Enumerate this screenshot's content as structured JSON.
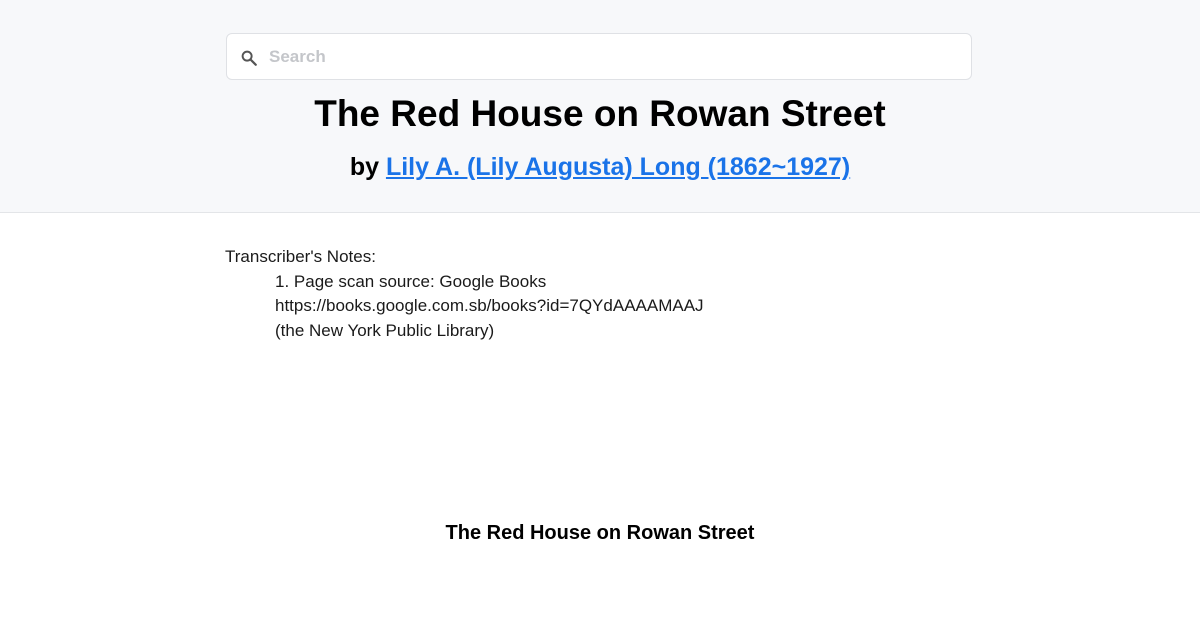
{
  "search": {
    "placeholder": "Search",
    "value": ""
  },
  "book": {
    "title": "The Red House on Rowan Street",
    "by_prefix": "by ",
    "author": "Lily A. (Lily Augusta) Long (1862~1927)"
  },
  "notes": {
    "heading": "Transcriber's Notes:",
    "lines": [
      "1. Page scan source: Google Books",
      "https://books.google.com.sb/books?id=7QYdAAAAMAAJ",
      "(the New York Public Library)"
    ]
  },
  "content": {
    "title": "The Red House on Rowan Street"
  },
  "colors": {
    "link": "#1a73e8",
    "header_bg": "#f7f8fa"
  },
  "icons": {
    "search": "search-icon"
  }
}
